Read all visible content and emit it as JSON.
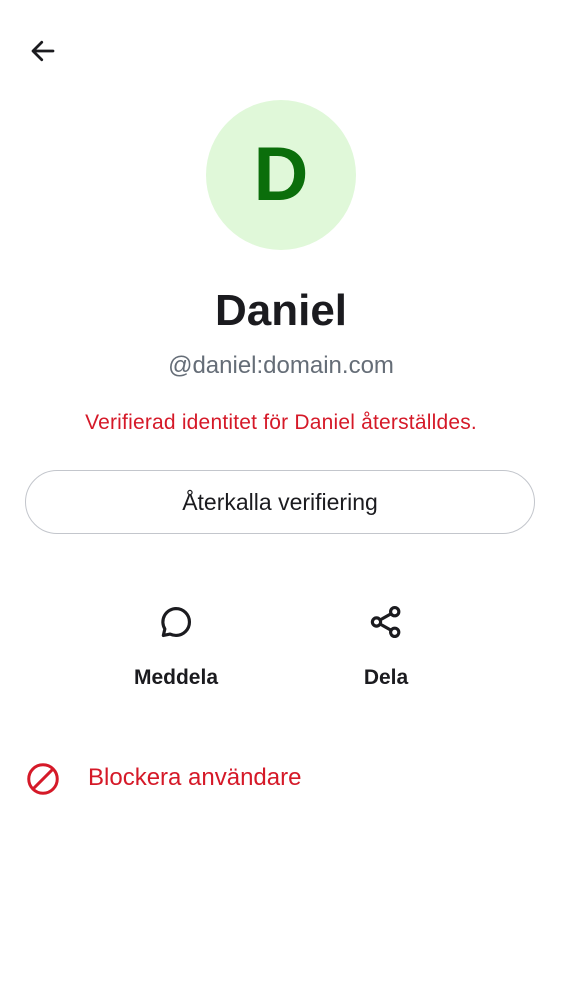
{
  "colors": {
    "critical": "#d51928",
    "avatar_bg": "#e0f8d9",
    "avatar_fg": "#0b6e0b",
    "text_primary": "#1b1b1f",
    "text_secondary": "#656d77",
    "outline": "#c3c6cc"
  },
  "header": {
    "back_icon": "arrow-left-icon"
  },
  "profile": {
    "avatar_initial": "D",
    "display_name": "Daniel",
    "user_id": "@daniel:domain.com",
    "verification_warning": "Verifierad identitet för Daniel återställdes."
  },
  "verification": {
    "revoke_label": "Återkalla verifiering"
  },
  "actions": [
    {
      "icon": "chat-bubble-icon",
      "label": "Meddela"
    },
    {
      "icon": "share-icon",
      "label": "Dela"
    }
  ],
  "block": {
    "icon": "block-icon",
    "label": "Blockera användare"
  }
}
